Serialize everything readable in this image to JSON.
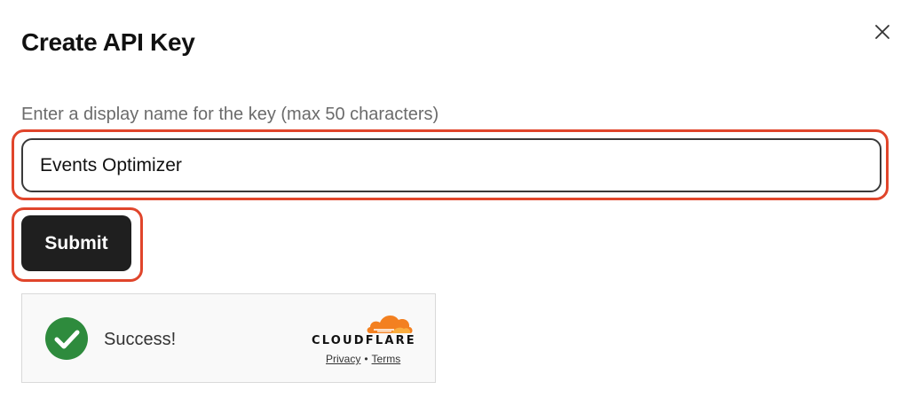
{
  "dialog": {
    "title": "Create API Key",
    "close_icon": "close-icon"
  },
  "form": {
    "label": "Enter a display name for the key (max 50 characters)",
    "input_value": "Events Optimizer",
    "submit_label": "Submit"
  },
  "turnstile": {
    "status_icon": "checkmark-circle-icon",
    "status_text": "Success!",
    "brand_icon": "cloudflare-cloud-icon",
    "brand_name": "CLOUDFLARE",
    "links": {
      "privacy": "Privacy",
      "separator": "•",
      "terms": "Terms"
    }
  },
  "colors": {
    "highlight": "#e0452b",
    "button_bg": "#1f1f1f",
    "success_green": "#2e8b3d",
    "cloudflare_orange": "#f38020"
  }
}
